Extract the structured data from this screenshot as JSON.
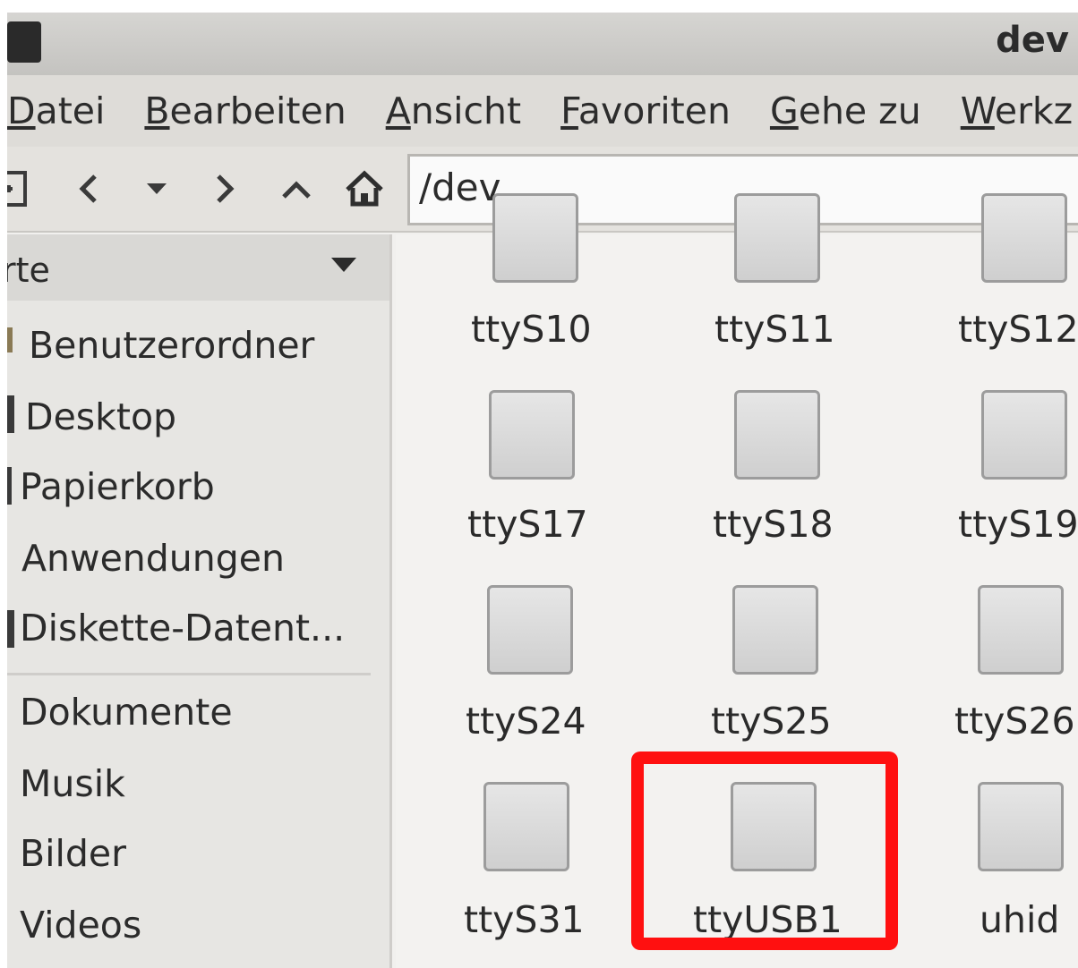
{
  "window": {
    "title": "dev"
  },
  "menubar": {
    "items": [
      {
        "accel": "D",
        "rest": "atei"
      },
      {
        "accel": "B",
        "rest": "earbeiten"
      },
      {
        "accel": "A",
        "rest": "nsicht"
      },
      {
        "accel": "F",
        "rest": "avoriten"
      },
      {
        "accel": "G",
        "rest": "ehe zu"
      },
      {
        "accel": "W",
        "rest": "erkz"
      }
    ]
  },
  "toolbar": {
    "path": "/dev"
  },
  "sidebar": {
    "header": "rte",
    "items": [
      {
        "label": "Benutzerordner"
      },
      {
        "label": "Desktop"
      },
      {
        "label": "Papierkorb"
      },
      {
        "label": "Anwendungen"
      },
      {
        "label": "Diskette-Datent..."
      },
      {
        "label": "Dokumente"
      },
      {
        "label": "Musik"
      },
      {
        "label": "Bilder"
      },
      {
        "label": "Videos"
      }
    ]
  },
  "files": [
    {
      "name": "ttyS10"
    },
    {
      "name": "ttyS11"
    },
    {
      "name": "ttyS12"
    },
    {
      "name": "ttyS17"
    },
    {
      "name": "ttyS18"
    },
    {
      "name": "ttyS19"
    },
    {
      "name": "ttyS24"
    },
    {
      "name": "ttyS25"
    },
    {
      "name": "ttyS26"
    },
    {
      "name": "ttyS31"
    },
    {
      "name": "ttyUSB1"
    },
    {
      "name": "uhid"
    }
  ],
  "colors": {
    "highlight": "#ff1010"
  }
}
